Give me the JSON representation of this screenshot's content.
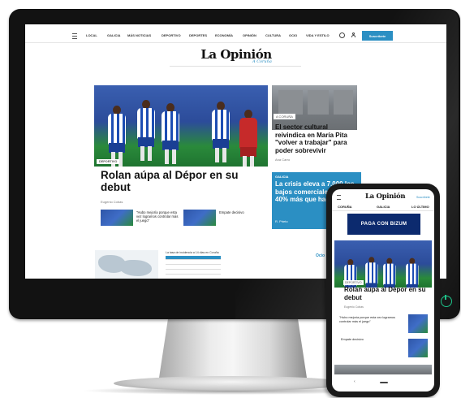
{
  "site": {
    "logo": "La Opinión",
    "logo_sub": "A Coruña",
    "subscribe_label": "Suscríbete"
  },
  "nav": {
    "items": [
      "LOCAL",
      "GALICIA",
      "MÁS NOTICIAS",
      "DEPORTIVO",
      "DEPORTES",
      "ECONOMÍA",
      "OPINIÓN",
      "CULTURA",
      "OCIO",
      "VIDA Y ESTILO"
    ]
  },
  "hero": {
    "tag": "DEPORTIVO",
    "title": "Rolan aúpa al Dépor en su debut",
    "author": "Eugenio Cobas",
    "related": [
      {
        "text": "\"Hubo mejoría porque esta vez logramos controlar más el juego\""
      },
      {
        "text": "Empate decisivo"
      }
    ]
  },
  "side": {
    "tag": "A CORUÑA",
    "title": "El sector cultural reivindica en María Pita \"volver a trabajar\" para poder sobrevivir",
    "author": "Ana Carro"
  },
  "blue_story": {
    "tag": "GALICIA",
    "title": "La crisis eleva a 7.000 los bajos comerciales y un 40% más que hace un año",
    "author": "R. Prieto"
  },
  "lower": {
    "table_title": "La tasa de incidencia a 14 días en Coruña",
    "ocio_label": "Ocio"
  },
  "phone": {
    "logo": "La Opinión",
    "subscribe_label": "Suscríbete",
    "nav": [
      "CORUÑA",
      "GALICIA",
      "LO ÚLTIMO"
    ],
    "ad_text": "PAGA CON BIZUM",
    "tag": "DEPORTIVO",
    "title": "Rolan aúpa al Dépor en su debut",
    "author": "Eugenio Cobas",
    "related_1": "\"Hubo mejoría porque esta vez logramos controlar más el juego\"",
    "related_2": "Empate decisivo"
  },
  "colors": {
    "accent": "#2b8fc3",
    "power_led": "#1ec48a",
    "bizum_ad": "#0c2a6e"
  }
}
